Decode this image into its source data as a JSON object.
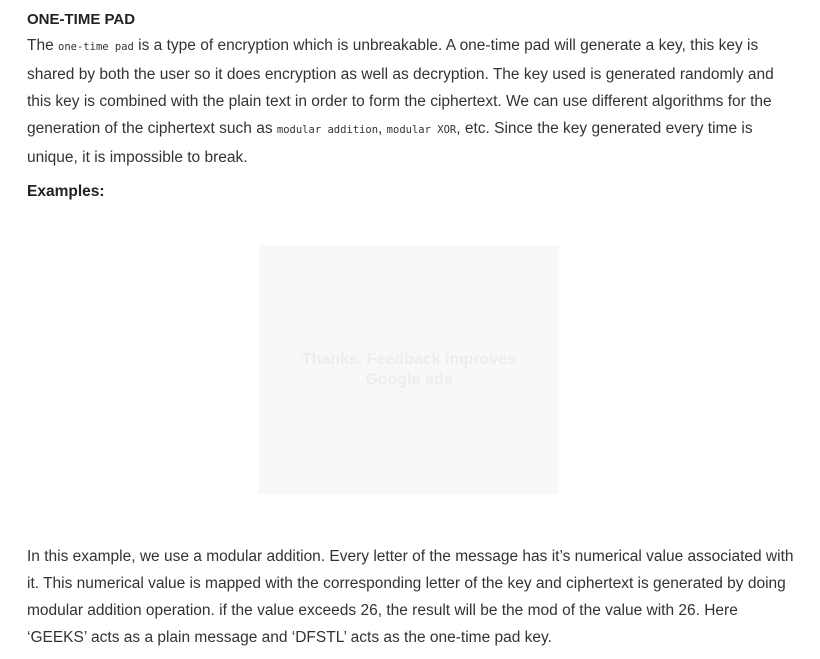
{
  "heading": "ONE-TIME PAD",
  "intro": {
    "t1": "The ",
    "code1": "one-time pad",
    "t2": " is a type of encryption which is unbreakable. A one-time pad will generate a key, this key is shared by both the user so it does encryption as well as decryption. The key used is generated randomly and this key is combined with the plain text in order to form the ciphertext. We can use different algorithms for the generation of the ciphertext such as ",
    "code2": "modular addition",
    "t3": ", ",
    "code3": "modular XOR",
    "t4": ", etc. Since the key generated every time is unique, it is impossible to break."
  },
  "examples_label": "Examples:",
  "ad": {
    "line1": "Thanks. Feedback improves",
    "line2": "Google ads"
  },
  "explanation": "In this example, we use a modular addition. Every letter of the message has it’s numerical value associated with it. This numerical value is mapped with the corresponding letter of the key and ciphertext is generated by doing modular addition operation. if the value exceeds 26, the result will be the mod of the value with 26. Here ‘GEEKS’ acts as a plain message and ‘DFSTL’ acts as the one-time pad key."
}
